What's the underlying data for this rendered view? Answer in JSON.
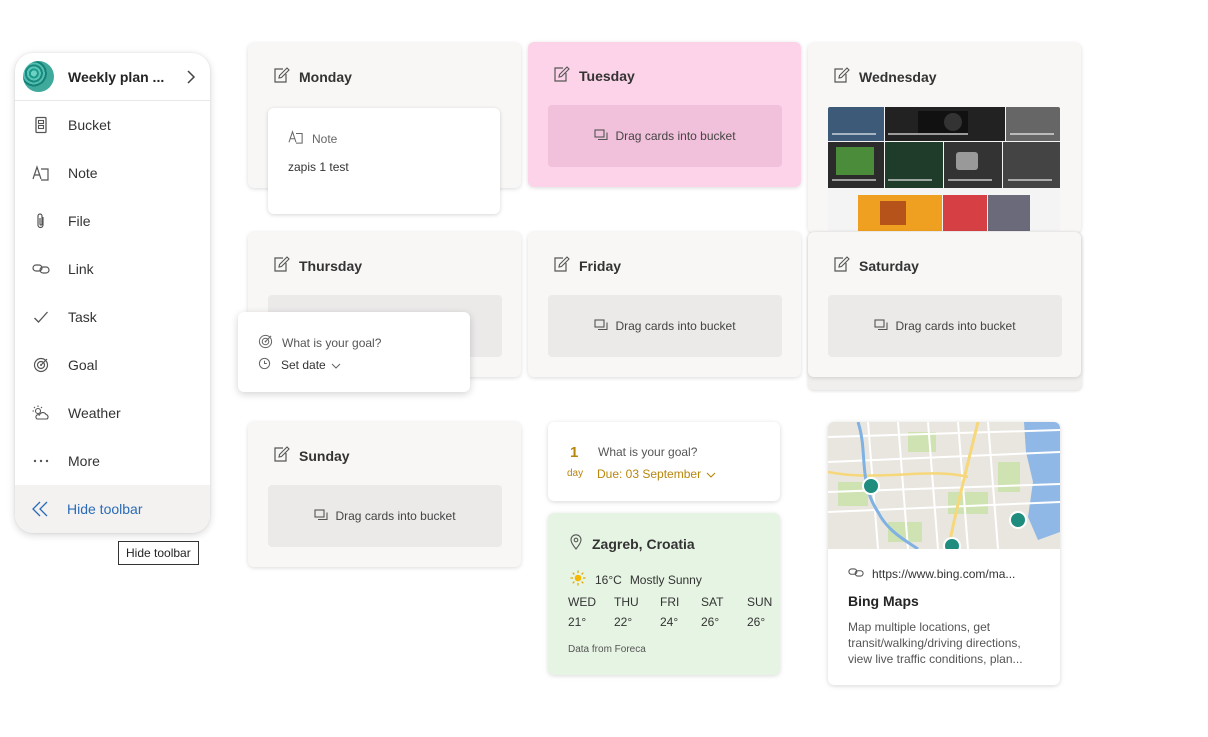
{
  "toolbar": {
    "title": "Weekly plan ...",
    "items": [
      {
        "label": "Bucket",
        "icon": "bucket-icon"
      },
      {
        "label": "Note",
        "icon": "note-icon"
      },
      {
        "label": "File",
        "icon": "paperclip-icon"
      },
      {
        "label": "Link",
        "icon": "link-icon"
      },
      {
        "label": "Task",
        "icon": "checkmark-icon"
      },
      {
        "label": "Goal",
        "icon": "target-icon"
      },
      {
        "label": "Weather",
        "icon": "weather-icon"
      },
      {
        "label": "More",
        "icon": "more-icon"
      }
    ],
    "hide_label": "Hide toolbar",
    "tooltip": "Hide toolbar",
    "accent": "#2b6bb5"
  },
  "buckets": {
    "monday": {
      "title": "Monday",
      "note_label": "Note",
      "note_text": "zapis 1 test"
    },
    "tuesday": {
      "title": "Tuesday",
      "drop": "Drag cards into bucket",
      "color": "#fcd3e8"
    },
    "wednesday": {
      "title": "Wednesday"
    },
    "thursday": {
      "title": "Thursday"
    },
    "friday": {
      "title": "Friday",
      "drop": "Drag cards into bucket"
    },
    "saturday": {
      "title": "Saturday",
      "drop": "Drag cards into bucket"
    },
    "sunday": {
      "title": "Sunday",
      "drop": "Drag cards into bucket"
    }
  },
  "goal_popup": {
    "prompt": "What is your goal?",
    "set_date": "Set date"
  },
  "goal_card": {
    "number": "1",
    "unit": "day",
    "prompt": "What is your goal?",
    "due": "Due: 03 September",
    "accent": "#b8860b"
  },
  "weather": {
    "location": "Zagreb, Croatia",
    "temp": "16°C",
    "condition": "Mostly Sunny",
    "days": [
      {
        "day": "WED",
        "temp": "21°"
      },
      {
        "day": "THU",
        "temp": "22°"
      },
      {
        "day": "FRI",
        "temp": "24°"
      },
      {
        "day": "SAT",
        "temp": "26°"
      },
      {
        "day": "SUN",
        "temp": "26°"
      }
    ],
    "source": "Data from Foreca",
    "color": "#e6f4e3"
  },
  "link_card": {
    "url": "https://www.bing.com/ma...",
    "title": "Bing Maps",
    "description": "Map multiple locations, get transit/walking/driving directions, view live traffic conditions, plan..."
  }
}
